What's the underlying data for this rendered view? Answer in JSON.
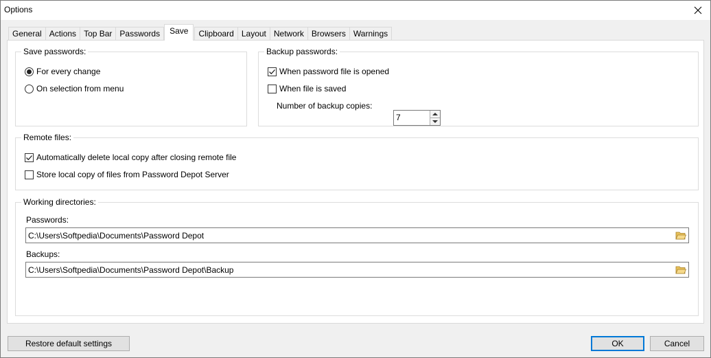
{
  "window": {
    "title": "Options"
  },
  "tabs": [
    {
      "label": "General",
      "active": false
    },
    {
      "label": "Actions",
      "active": false
    },
    {
      "label": "Top Bar",
      "active": false
    },
    {
      "label": "Passwords",
      "active": false
    },
    {
      "label": "Save",
      "active": true
    },
    {
      "label": "Clipboard",
      "active": false
    },
    {
      "label": "Layout",
      "active": false
    },
    {
      "label": "Network",
      "active": false
    },
    {
      "label": "Browsers",
      "active": false
    },
    {
      "label": "Warnings",
      "active": false
    }
  ],
  "save_passwords": {
    "title": "Save passwords:",
    "options": [
      {
        "label": "For every change",
        "selected": true
      },
      {
        "label": "On selection from menu",
        "selected": false
      }
    ]
  },
  "backup_passwords": {
    "title": "Backup passwords:",
    "when_opened": {
      "label": "When password file is opened",
      "checked": true
    },
    "when_saved": {
      "label": "When file is saved",
      "checked": false
    },
    "copies_label": "Number of backup copies:",
    "copies_value": "7"
  },
  "remote_files": {
    "title": "Remote files:",
    "auto_delete": {
      "label": "Automatically delete local copy after closing remote file",
      "checked": true
    },
    "store_local": {
      "label": "Store local copy of files from Password Depot Server",
      "checked": false
    }
  },
  "working_directories": {
    "title": "Working directories:",
    "passwords_label": "Passwords:",
    "passwords_path": "C:\\Users\\Softpedia\\Documents\\Password Depot",
    "backups_label": "Backups:",
    "backups_path": "C:\\Users\\Softpedia\\Documents\\Password Depot\\Backup"
  },
  "buttons": {
    "restore": "Restore default settings",
    "ok": "OK",
    "cancel": "Cancel"
  },
  "colors": {
    "accent": "#0078d7",
    "folder": "#e8c15a"
  }
}
